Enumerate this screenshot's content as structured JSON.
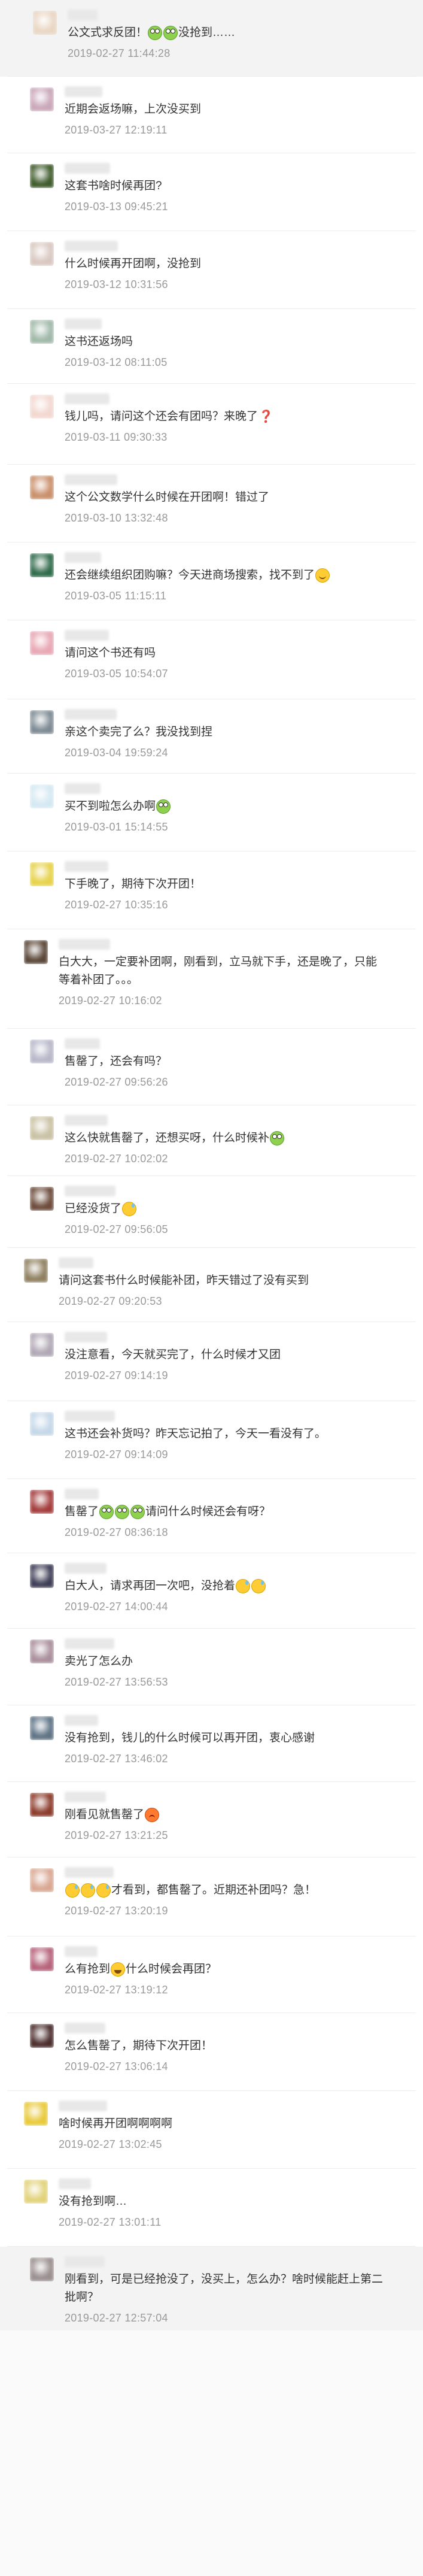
{
  "comments": [
    {
      "segments": [
        {
          "t": "公文式求反团！"
        },
        {
          "e": "frog"
        },
        {
          "e": "frog"
        },
        {
          "t": "没抢到……"
        }
      ],
      "time": "2019-02-27 11:44:28",
      "highlight": true,
      "avatar_color": "#e9d6c3"
    },
    {
      "segments": [
        {
          "t": "近期会返场嘛，上次没买到"
        }
      ],
      "time": "2019-03-27 12:19:11",
      "highlight": false,
      "avatar_color": "#c9a7b8"
    },
    {
      "segments": [
        {
          "t": "这套书啥时候再团?"
        }
      ],
      "time": "2019-03-13 09:45:21",
      "highlight": false,
      "avatar_color": "#3e5a2a"
    },
    {
      "segments": [
        {
          "t": "什么时候再开团啊，没抢到"
        }
      ],
      "time": "2019-03-12 10:31:56",
      "highlight": false,
      "avatar_color": "#d8c7c0"
    },
    {
      "segments": [
        {
          "t": "这书还返场吗"
        }
      ],
      "time": "2019-03-12 08:11:05",
      "highlight": false,
      "avatar_color": "#9fb8a8"
    },
    {
      "segments": [
        {
          "t": "钱儿吗，请问这个还会有团吗？来晚了"
        },
        {
          "e": "question"
        }
      ],
      "time": "2019-03-11 09:30:33",
      "highlight": false,
      "avatar_color": "#f2d7d0"
    },
    {
      "segments": [
        {
          "t": "这个公文数学什么时候在开团啊！错过了"
        }
      ],
      "time": "2019-03-10 13:32:48",
      "highlight": false,
      "avatar_color": "#c98f6a"
    },
    {
      "segments": [
        {
          "t": "还会继续组织团购嘛？今天进商场搜索，找不到了"
        },
        {
          "e": "smile"
        }
      ],
      "time": "2019-03-05 11:15:11",
      "highlight": false,
      "avatar_color": "#2f6a4a"
    },
    {
      "segments": [
        {
          "t": "请问这个书还有吗"
        }
      ],
      "time": "2019-03-05 10:54:07",
      "highlight": false,
      "avatar_color": "#e7a6b3"
    },
    {
      "segments": [
        {
          "t": "亲这个卖完了么？我没找到捏"
        }
      ],
      "time": "2019-03-04 19:59:24",
      "highlight": false,
      "avatar_color": "#7c8a93"
    },
    {
      "segments": [
        {
          "t": "买不到啦怎么办啊"
        },
        {
          "e": "frog"
        }
      ],
      "time": "2019-03-01 15:14:55",
      "highlight": false,
      "avatar_color": "#d4e8f2"
    },
    {
      "segments": [
        {
          "t": "下手晚了，期待下次开团！"
        }
      ],
      "time": "2019-02-27 10:35:16",
      "highlight": false,
      "avatar_color": "#e6d24a"
    },
    {
      "segments": [
        {
          "t": "白大大，一定要补团啊，刚看到，立马就下手，还是晚了，只能等着补团了。。。"
        }
      ],
      "time": "2019-02-27 10:16:02",
      "highlight": false,
      "avatar_color": "#5a4638"
    },
    {
      "segments": [
        {
          "t": "售罄了，还会有吗？"
        }
      ],
      "time": "2019-02-27 09:56:26",
      "highlight": false,
      "avatar_color": "#b7b7c9"
    },
    {
      "segments": [
        {
          "t": "这么快就售罄了，还想买呀，什么时候补"
        },
        {
          "e": "frog"
        }
      ],
      "time": "2019-02-27 10:02:02",
      "highlight": false,
      "avatar_color": "#c9c1a3"
    },
    {
      "segments": [
        {
          "t": "已经没货了"
        },
        {
          "e": "sweat"
        }
      ],
      "time": "2019-02-27 09:56:05",
      "highlight": false,
      "avatar_color": "#6b4a3a"
    },
    {
      "segments": [
        {
          "t": "请问这套书什么时候能补团，昨天错过了没有买到"
        }
      ],
      "time": "2019-02-27 09:20:53",
      "highlight": false,
      "avatar_color": "#8e7f5e"
    },
    {
      "segments": [
        {
          "t": "没注意看，今天就买完了，什么时候才又团"
        }
      ],
      "time": "2019-02-27 09:14:19",
      "highlight": false,
      "avatar_color": "#b0a7b5"
    },
    {
      "segments": [
        {
          "t": "这书还会补货吗？昨天忘记拍了，今天一看没有了。"
        }
      ],
      "time": "2019-02-27 09:14:09",
      "highlight": false,
      "avatar_color": "#c4d7e8"
    },
    {
      "segments": [
        {
          "t": "售罄了"
        },
        {
          "e": "frog"
        },
        {
          "e": "frog"
        },
        {
          "e": "frog"
        },
        {
          "t": "请问什么时候还会有呀？"
        }
      ],
      "time": "2019-02-27 08:36:18",
      "highlight": false,
      "avatar_color": "#a33b3b"
    },
    {
      "segments": [
        {
          "t": "白大人，请求再团一次吧，没抢着"
        },
        {
          "e": "sweat"
        },
        {
          "e": "sweat"
        }
      ],
      "time": "2019-02-27 14:00:44",
      "highlight": false,
      "avatar_color": "#3c3c55"
    },
    {
      "segments": [
        {
          "t": "卖光了怎么办"
        }
      ],
      "time": "2019-02-27 13:56:53",
      "highlight": false,
      "avatar_color": "#a98e9b"
    },
    {
      "segments": [
        {
          "t": "没有抢到，钱儿的什么时候可以再开团，衷心感谢"
        }
      ],
      "time": "2019-02-27 13:46:02",
      "highlight": false,
      "avatar_color": "#5e7385"
    },
    {
      "segments": [
        {
          "t": "刚看见就售罄了"
        },
        {
          "e": "angry"
        }
      ],
      "time": "2019-02-27 13:21:25",
      "highlight": false,
      "avatar_color": "#8b3a2a"
    },
    {
      "segments": [
        {
          "e": "sweat"
        },
        {
          "e": "sweat"
        },
        {
          "e": "sweat"
        },
        {
          "t": "才看到，都售罄了。近期还补团吗？急！"
        }
      ],
      "time": "2019-02-27 13:20:19",
      "highlight": false,
      "avatar_color": "#d9a792"
    },
    {
      "segments": [
        {
          "t": "么有抢到"
        },
        {
          "e": "grin"
        },
        {
          "t": "什么时候会再团？"
        }
      ],
      "time": "2019-02-27 13:19:12",
      "highlight": false,
      "avatar_color": "#b5627a"
    },
    {
      "segments": [
        {
          "t": "怎么售罄了，期待下次开团！"
        }
      ],
      "time": "2019-02-27 13:06:14",
      "highlight": false,
      "avatar_color": "#4a2c2c"
    },
    {
      "segments": [
        {
          "t": "啥时候再开团啊啊啊啊"
        }
      ],
      "time": "2019-02-27 13:02:45",
      "highlight": false,
      "avatar_color": "#e8c93a"
    },
    {
      "segments": [
        {
          "t": "没有抢到啊…"
        }
      ],
      "time": "2019-02-27 13:01:11",
      "highlight": false,
      "avatar_color": "#e2d27a"
    },
    {
      "segments": [
        {
          "t": "刚看到，可是已经抢没了，没买上，怎么办？啥时候能赶上第二批啊？"
        }
      ],
      "time": "2019-02-27 12:57:04",
      "highlight": true,
      "avatar_color": "#9a8e8e"
    }
  ]
}
